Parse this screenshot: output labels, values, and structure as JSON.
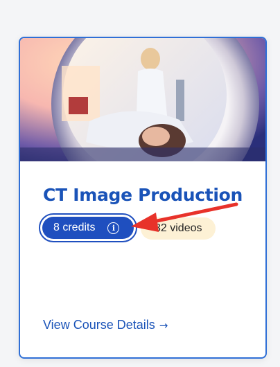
{
  "course": {
    "title": "CT Image Production",
    "credits_label": "8 credits",
    "info_icon_glyph": "i",
    "videos_label": "32 videos",
    "details_link_label": "View Course Details",
    "details_arrow": "→",
    "hero_image_alt": "CT scanner with patient"
  },
  "colors": {
    "brand_blue": "#1f4fbf",
    "card_border": "#2f6fd6",
    "videos_badge_bg": "#fdf1d5",
    "annotation_arrow": "#e8322a"
  }
}
